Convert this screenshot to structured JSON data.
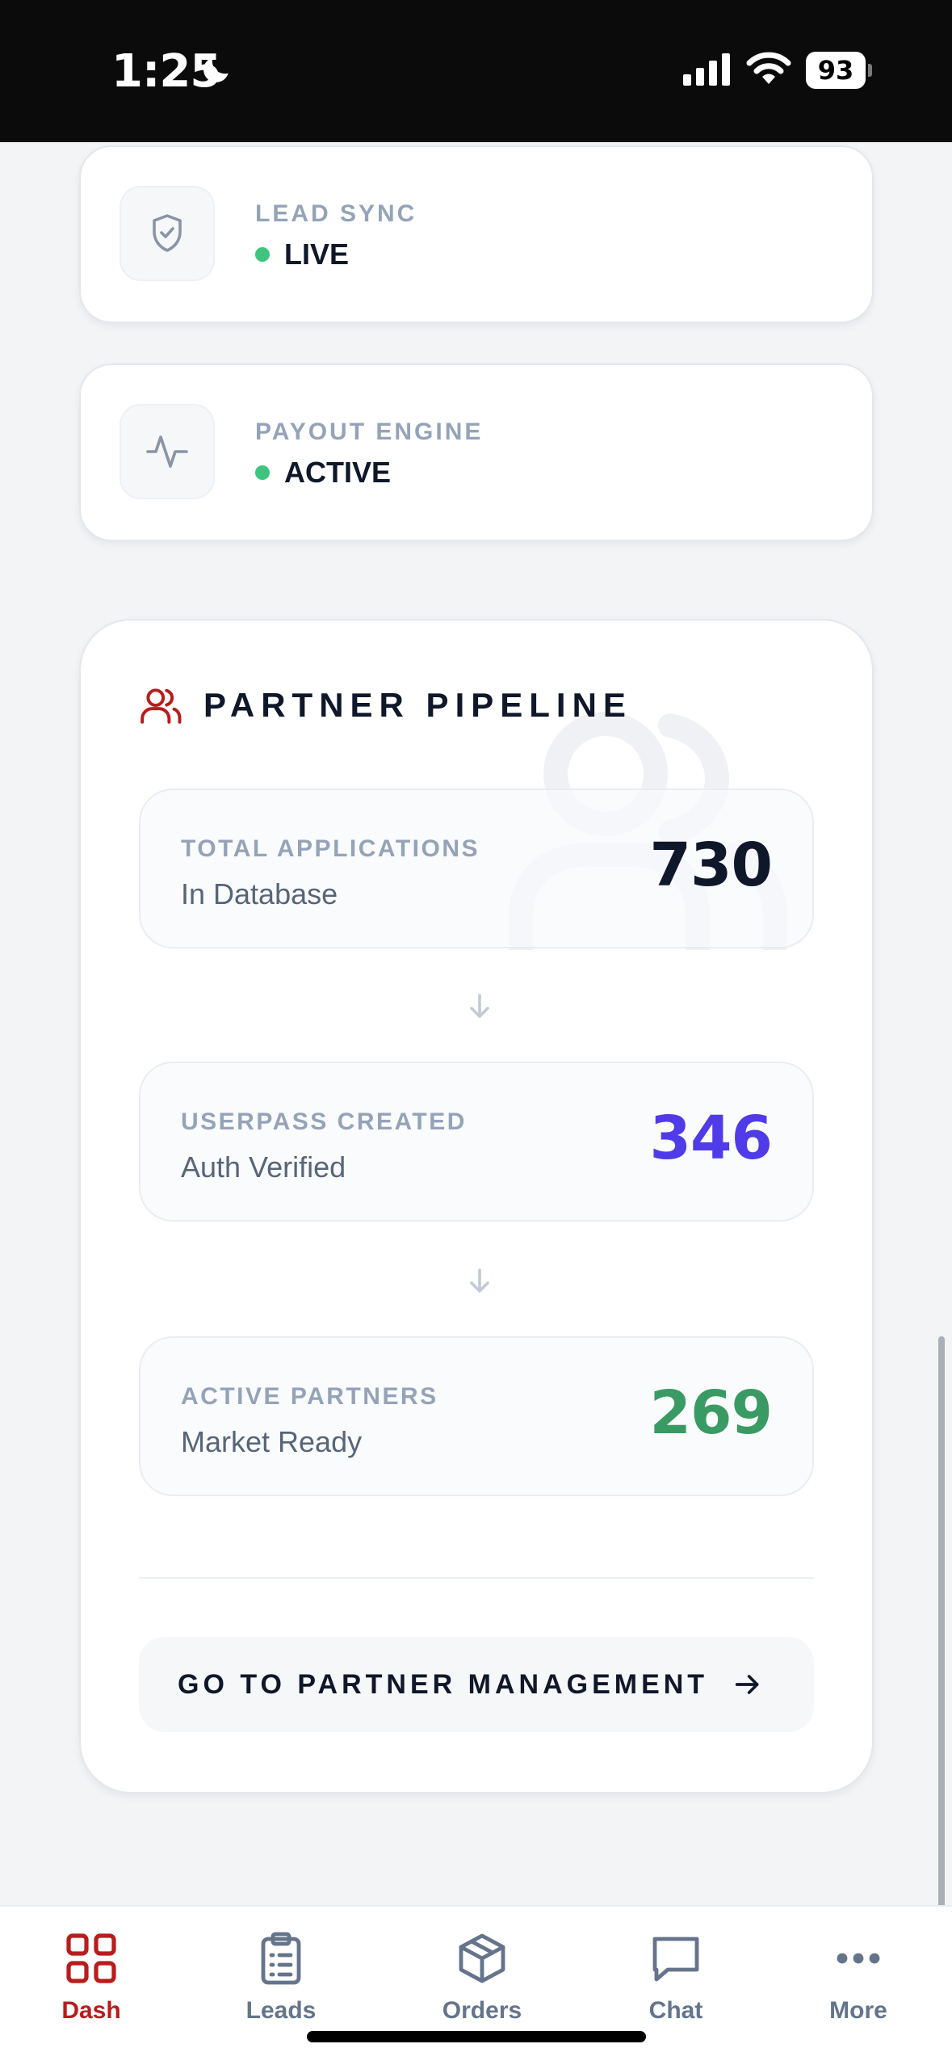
{
  "status_bar": {
    "time": "1:25",
    "battery": "93"
  },
  "status_cards": [
    {
      "label": "LEAD SYNC",
      "status": "LIVE",
      "icon": "shield-check-icon",
      "dot_color": "#3ec47f"
    },
    {
      "label": "PAYOUT ENGINE",
      "status": "ACTIVE",
      "icon": "activity-pulse-icon",
      "dot_color": "#3ec47f"
    }
  ],
  "pipeline": {
    "title": "PARTNER PIPELINE",
    "icon": "users-icon",
    "accent": "#b91c1c",
    "metrics": [
      {
        "label": "TOTAL APPLICATIONS",
        "sub": "In Database",
        "value": "730",
        "color": "#0f172a"
      },
      {
        "label": "USERPASS CREATED",
        "sub": "Auth Verified",
        "value": "346",
        "color": "#4f3be8"
      },
      {
        "label": "ACTIVE PARTNERS",
        "sub": "Market Ready",
        "value": "269",
        "color": "#3a9a64"
      }
    ],
    "cta_label": "GO TO PARTNER MANAGEMENT"
  },
  "tabs": [
    {
      "label": "Dash",
      "icon": "grid-icon",
      "active": true
    },
    {
      "label": "Leads",
      "icon": "clipboard-list-icon",
      "active": false
    },
    {
      "label": "Orders",
      "icon": "package-icon",
      "active": false
    },
    {
      "label": "Chat",
      "icon": "chat-bubble-icon",
      "active": false
    },
    {
      "label": "More",
      "icon": "more-dots-icon",
      "active": false
    }
  ]
}
